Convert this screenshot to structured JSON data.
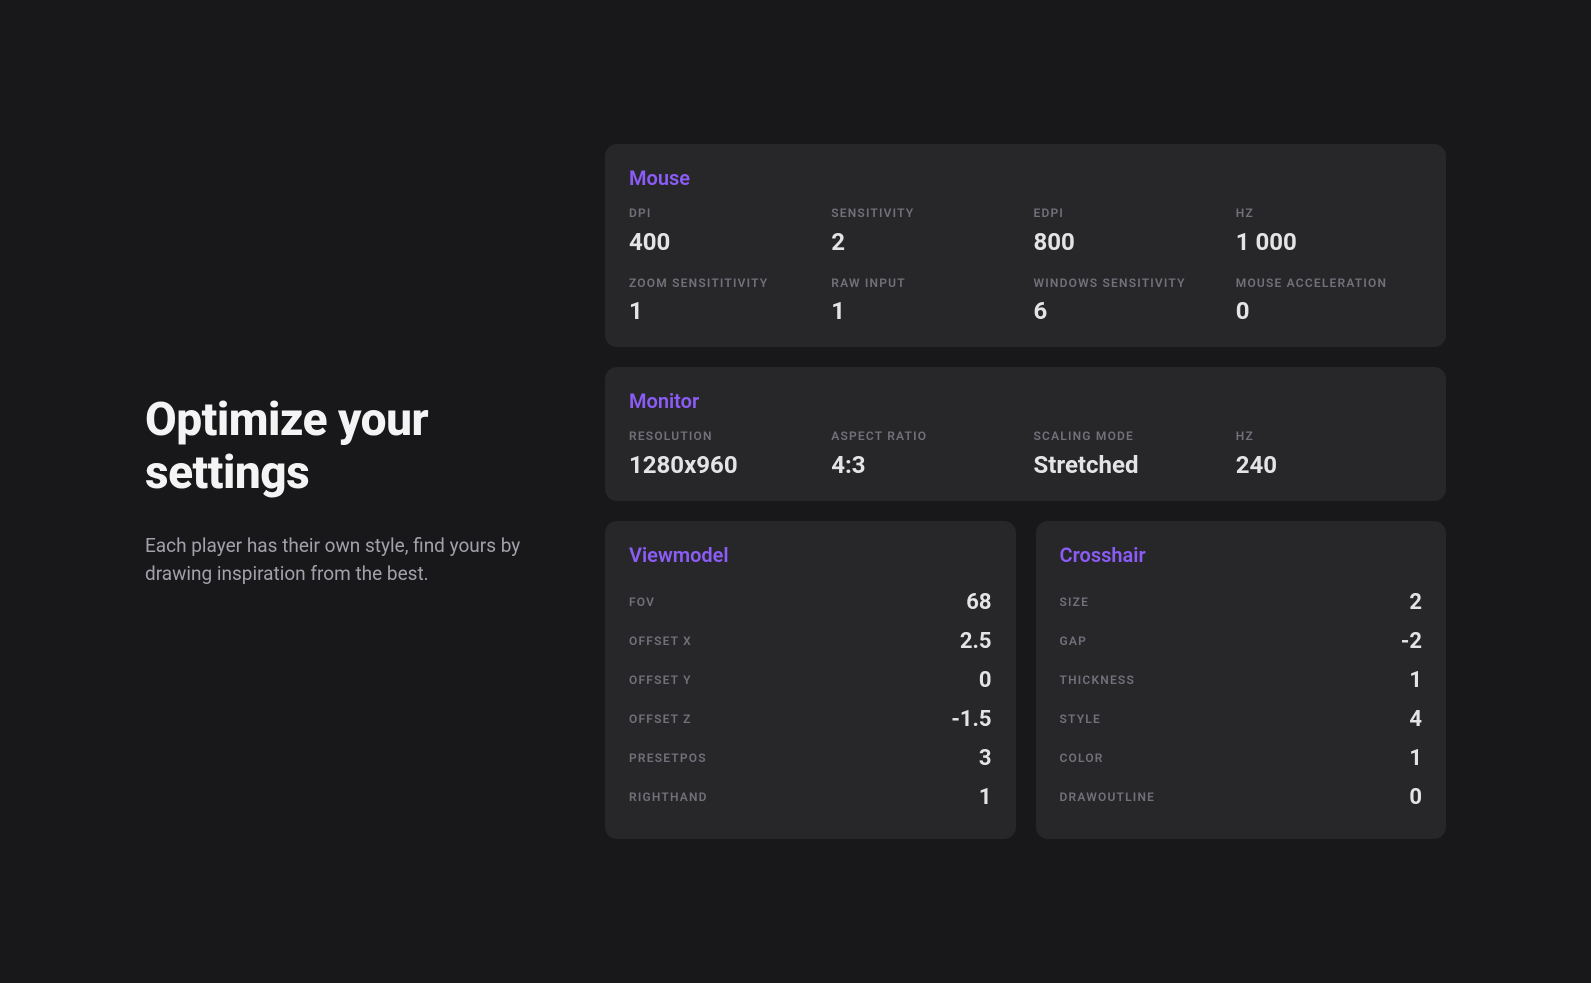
{
  "heading": "Optimize your settings",
  "subheading": "Each player has their own style, find yours by drawing inspiration from the best.",
  "mouse": {
    "title": "Mouse",
    "stats": [
      {
        "label": "DPI",
        "value": "400"
      },
      {
        "label": "SENSITIVITY",
        "value": "2"
      },
      {
        "label": "EDPI",
        "value": "800"
      },
      {
        "label": "HZ",
        "value": "1 000"
      },
      {
        "label": "ZOOM SENSITITIVITY",
        "value": "1"
      },
      {
        "label": "RAW INPUT",
        "value": "1"
      },
      {
        "label": "WINDOWS SENSITIVITY",
        "value": "6"
      },
      {
        "label": "MOUSE ACCELERATION",
        "value": "0"
      }
    ]
  },
  "monitor": {
    "title": "Monitor",
    "stats": [
      {
        "label": "RESOLUTION",
        "value": "1280x960"
      },
      {
        "label": "ASPECT RATIO",
        "value": "4:3"
      },
      {
        "label": "SCALING MODE",
        "value": "Stretched"
      },
      {
        "label": "HZ",
        "value": "240"
      }
    ]
  },
  "viewmodel": {
    "title": "Viewmodel",
    "rows": [
      {
        "label": "FOV",
        "value": "68"
      },
      {
        "label": "OFFSET X",
        "value": "2.5"
      },
      {
        "label": "OFFSET Y",
        "value": "0"
      },
      {
        "label": "OFFSET Z",
        "value": "-1.5"
      },
      {
        "label": "PRESETPOS",
        "value": "3"
      },
      {
        "label": "RIGHTHAND",
        "value": "1"
      }
    ]
  },
  "crosshair": {
    "title": "Crosshair",
    "rows": [
      {
        "label": "SIZE",
        "value": "2"
      },
      {
        "label": "GAP",
        "value": "-2"
      },
      {
        "label": "THICKNESS",
        "value": "1"
      },
      {
        "label": "STYLE",
        "value": "4"
      },
      {
        "label": "COLOR",
        "value": "1"
      },
      {
        "label": "DRAWOUTLINE",
        "value": "0"
      }
    ]
  }
}
